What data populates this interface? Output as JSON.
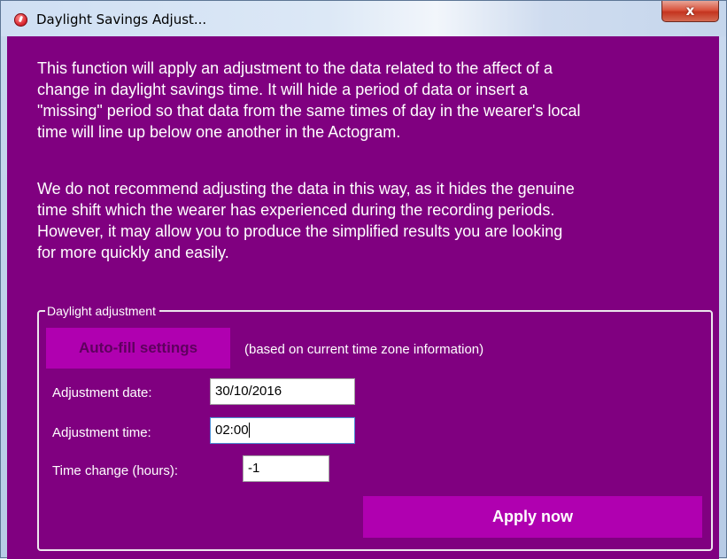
{
  "window": {
    "title": "Daylight Savings Adjust...",
    "close_glyph": "x",
    "icon": "app-icon"
  },
  "description": {
    "paragraph1": "This function will apply an adjustment to the data related to the affect of a\nchange in daylight savings time.  It will hide a period of data or insert a\n\"missing\" period so that data from the same times of day in the wearer's local\ntime will line up below one another in the Actogram.",
    "paragraph2": "We do not recommend adjusting the data in this way, as it hides the genuine\ntime shift which the wearer has experienced during the recording periods.\nHowever, it may allow you to produce the simplified results you are looking\nfor more quickly and easily."
  },
  "group": {
    "legend": "Daylight adjustment",
    "autofill_label": "Auto-fill settings",
    "autofill_note": "(based on current time zone information)",
    "date_label": "Adjustment date:",
    "date_value": "30/10/2016",
    "time_label": "Adjustment time:",
    "time_value": "02:00",
    "change_label": "Time change (hours):",
    "change_value": "-1",
    "apply_label": "Apply now"
  },
  "colors": {
    "background": "#800080",
    "button": "#b000b0",
    "disabled_text": "#5e005e",
    "text": "#ffffff"
  }
}
